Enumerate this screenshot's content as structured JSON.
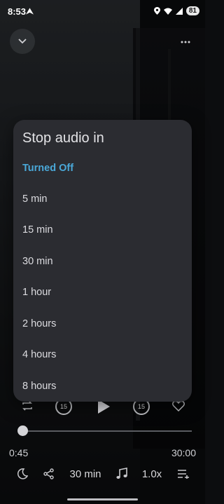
{
  "status_bar": {
    "time": "8:53",
    "battery": "81"
  },
  "dialog": {
    "title": "Stop audio in",
    "options": [
      {
        "label": "Turned Off",
        "selected": true
      },
      {
        "label": "5 min"
      },
      {
        "label": "15 min"
      },
      {
        "label": "30 min"
      },
      {
        "label": "1 hour"
      },
      {
        "label": "2 hours"
      },
      {
        "label": "4 hours"
      },
      {
        "label": "8 hours"
      }
    ]
  },
  "player": {
    "skip_back_seconds": "15",
    "skip_forward_seconds": "15",
    "current_time": "0:45",
    "total_time": "30:00",
    "progress_fraction": 0.025,
    "sleep_timer_label": "30 min",
    "speed_label": "1.0x"
  },
  "colors": {
    "accent": "#4aa8d8",
    "dialog_bg": "#2b2c31"
  },
  "icons": [
    "chevron-down-icon",
    "more-vert-icon",
    "repeat-icon",
    "replay-15-icon",
    "play-icon",
    "forward-15-icon",
    "heart-icon",
    "moon-icon",
    "share-icon",
    "music-note-icon",
    "queue-icon"
  ]
}
